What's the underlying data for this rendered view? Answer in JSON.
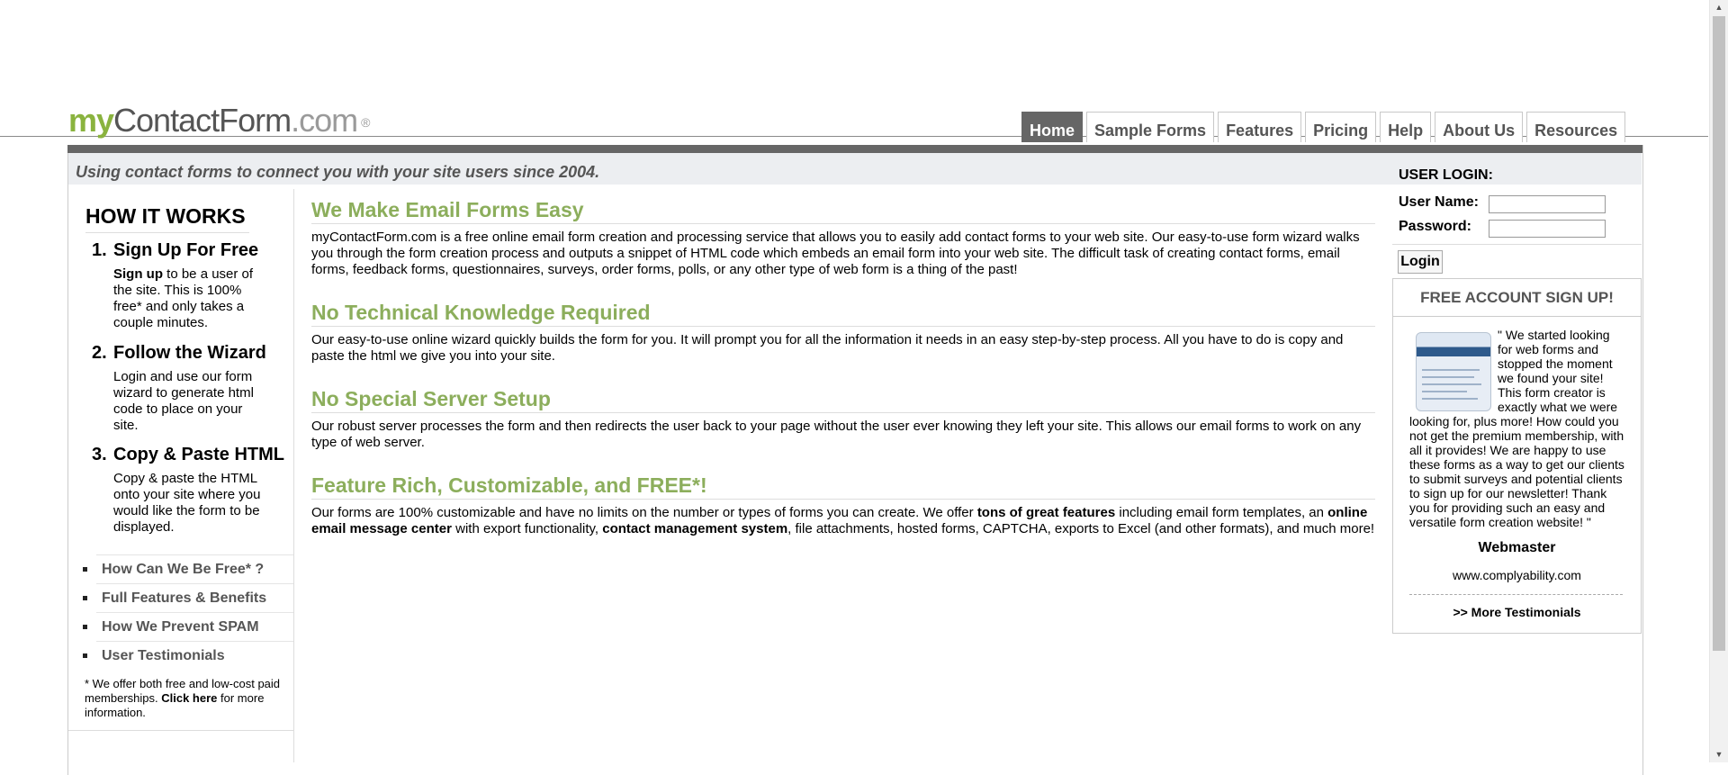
{
  "logo": {
    "my": "my",
    "contactform": "ContactForm",
    "dotcom": ".com",
    "reg": "®"
  },
  "nav": {
    "tabs": [
      "Home",
      "Sample Forms",
      "Features",
      "Pricing",
      "Help",
      "About Us",
      "Resources"
    ],
    "active": "Home"
  },
  "tagline": "Using contact forms to connect you with your site users since 2004.",
  "how_it_works": {
    "title": "HOW IT WORKS",
    "steps": [
      {
        "num": "1.",
        "title": "Sign Up For Free",
        "desc_bold": "Sign up",
        "desc": " to be a user of the site. This is 100% free* and only takes a couple minutes."
      },
      {
        "num": "2.",
        "title": "Follow the Wizard",
        "desc": "Login and use our form wizard to generate html code to place on your site."
      },
      {
        "num": "3.",
        "title": "Copy & Paste HTML",
        "desc": "Copy & paste the HTML onto your site where you would like the form to be displayed."
      }
    ],
    "links": [
      "How Can We Be Free* ?",
      "Full Features & Benefits",
      "How We Prevent SPAM",
      "User Testimonials"
    ],
    "footnote": {
      "pre": "* We offer both free and low-cost paid memberships. ",
      "bold": "Click here",
      "post": " for more information."
    }
  },
  "sections": [
    {
      "title": "We Make Email Forms Easy",
      "text": "myContactForm.com is a free online email form creation and processing service that allows you to easily add contact forms to your web site. Our easy-to-use form wizard walks you through the form creation process and outputs a snippet of HTML code which embeds an email form into your web site. The difficult task of creating contact forms, email forms, feedback forms, questionnaires, surveys, order forms, polls, or any other type of web form is a thing of the past!"
    },
    {
      "title": "No Technical Knowledge Required",
      "text": "Our easy-to-use online wizard quickly builds the form for you. It will prompt you for all the information it needs in an easy step-by-step process. All you have to do is copy and paste the html we give you into your site."
    },
    {
      "title": "No Special Server Setup",
      "text": "Our robust server processes the form and then redirects the user back to your page without the user ever knowing they left your site. This allows our email forms to work on any type of web server."
    },
    {
      "title": "Feature Rich, Customizable, and FREE*!",
      "t1": "Our forms are 100% customizable and have no limits on the number or types of forms you can create. We offer ",
      "b1": "tons of great features",
      "t2": " including email form templates, an ",
      "b2": "online email message center",
      "t3": " with export functionality, ",
      "b3": "contact management system",
      "t4": ", file attachments, hosted forms, CAPTCHA, exports to Excel (and other formats), and much more!"
    }
  ],
  "login": {
    "title": "USER LOGIN:",
    "username_label": "User Name:",
    "password_label": "Password:",
    "button": "Login",
    "username_value": "",
    "password_value": ""
  },
  "signup": {
    "label": "FREE ACCOUNT SIGN UP!"
  },
  "testimonial": {
    "quote": "\" We started looking for web forms and stopped the moment we found your site! This form creator is exactly what we were looking for, plus more! How could you not get the premium membership, with all it provides! We are happy to use these forms as a way to get our clients to submit surveys and potential clients to sign up for our newsletter! Thank you for providing such an easy and versatile form creation website! \"",
    "author": "Webmaster",
    "site": "www.complyability.com",
    "more": ">> More Testimonials"
  },
  "icons": {
    "scroll_up": "triangle-up",
    "scroll_down": "triangle-down"
  },
  "colors": {
    "accent_green": "#8cae5c",
    "logo_green": "#8ab33f",
    "active_tab": "#666666"
  }
}
